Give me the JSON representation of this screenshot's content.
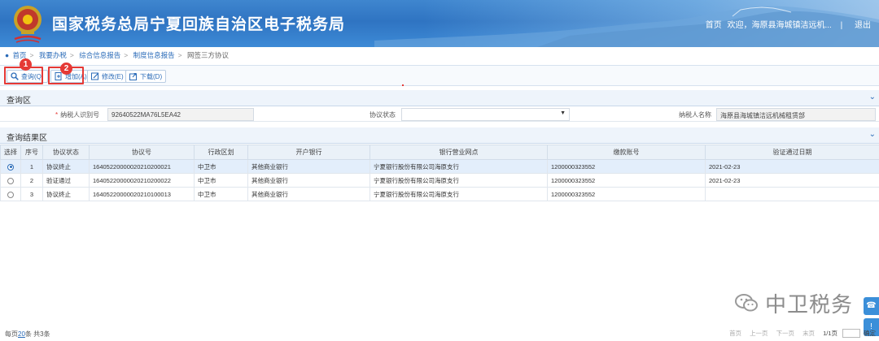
{
  "header": {
    "site_title": "国家税务总局宁夏回族自治区电子税务局",
    "home_link": "首页",
    "welcome": "欢迎，海原县海城镇洁远机...",
    "logout": "退出"
  },
  "breadcrumb": {
    "items": [
      "首页",
      "我要办税",
      "综合信息报告",
      "制度信息报告",
      "网签三方协议"
    ]
  },
  "toolbar": {
    "query": "查询(Q)",
    "add": "增加(A)",
    "edit": "修改(E)",
    "download": "下载(D)",
    "markers": [
      "1",
      "2"
    ]
  },
  "query_section": {
    "title": "查询区",
    "taxpayer_id_label": "纳税人识别号",
    "taxpayer_id_value": "92640522MA76L5EA42",
    "status_label": "协议状态",
    "status_value": "",
    "name_label": "纳税人名称",
    "name_value": "海原县海城镇洁远机械租赁部"
  },
  "results_section": {
    "title": "查询结果区",
    "columns": [
      "选择",
      "序号",
      "协议状态",
      "协议号",
      "行政区划",
      "开户银行",
      "银行营业网点",
      "缴款账号",
      "验证通过日期"
    ],
    "rows": [
      [
        "",
        "1",
        "协议终止",
        "16405220000020210200021",
        "中卫市",
        "其他商业银行",
        "宁夏银行股份有限公司海原支行",
        "1200000323552",
        "2021-02-23"
      ],
      [
        "",
        "2",
        "验证通过",
        "16405220000020210200022",
        "中卫市",
        "其他商业银行",
        "宁夏银行股份有限公司海原支行",
        "1200000323552",
        "2021-02-23"
      ],
      [
        "",
        "3",
        "协议终止",
        "16405220000020210100013",
        "中卫市",
        "其他商业银行",
        "宁夏银行股份有限公司海原支行",
        "1200000323552",
        ""
      ]
    ],
    "selected_row": 1
  },
  "watermark": {
    "text": "中卫税务"
  },
  "footer": {
    "per_page_prefix": "每页",
    "per_page_value": "20",
    "per_page_suffix": "条 共3条",
    "first": "首页",
    "prev": "上一页",
    "next": "下一页",
    "last": "末页",
    "page_info": "1/1页",
    "go": "确定"
  }
}
